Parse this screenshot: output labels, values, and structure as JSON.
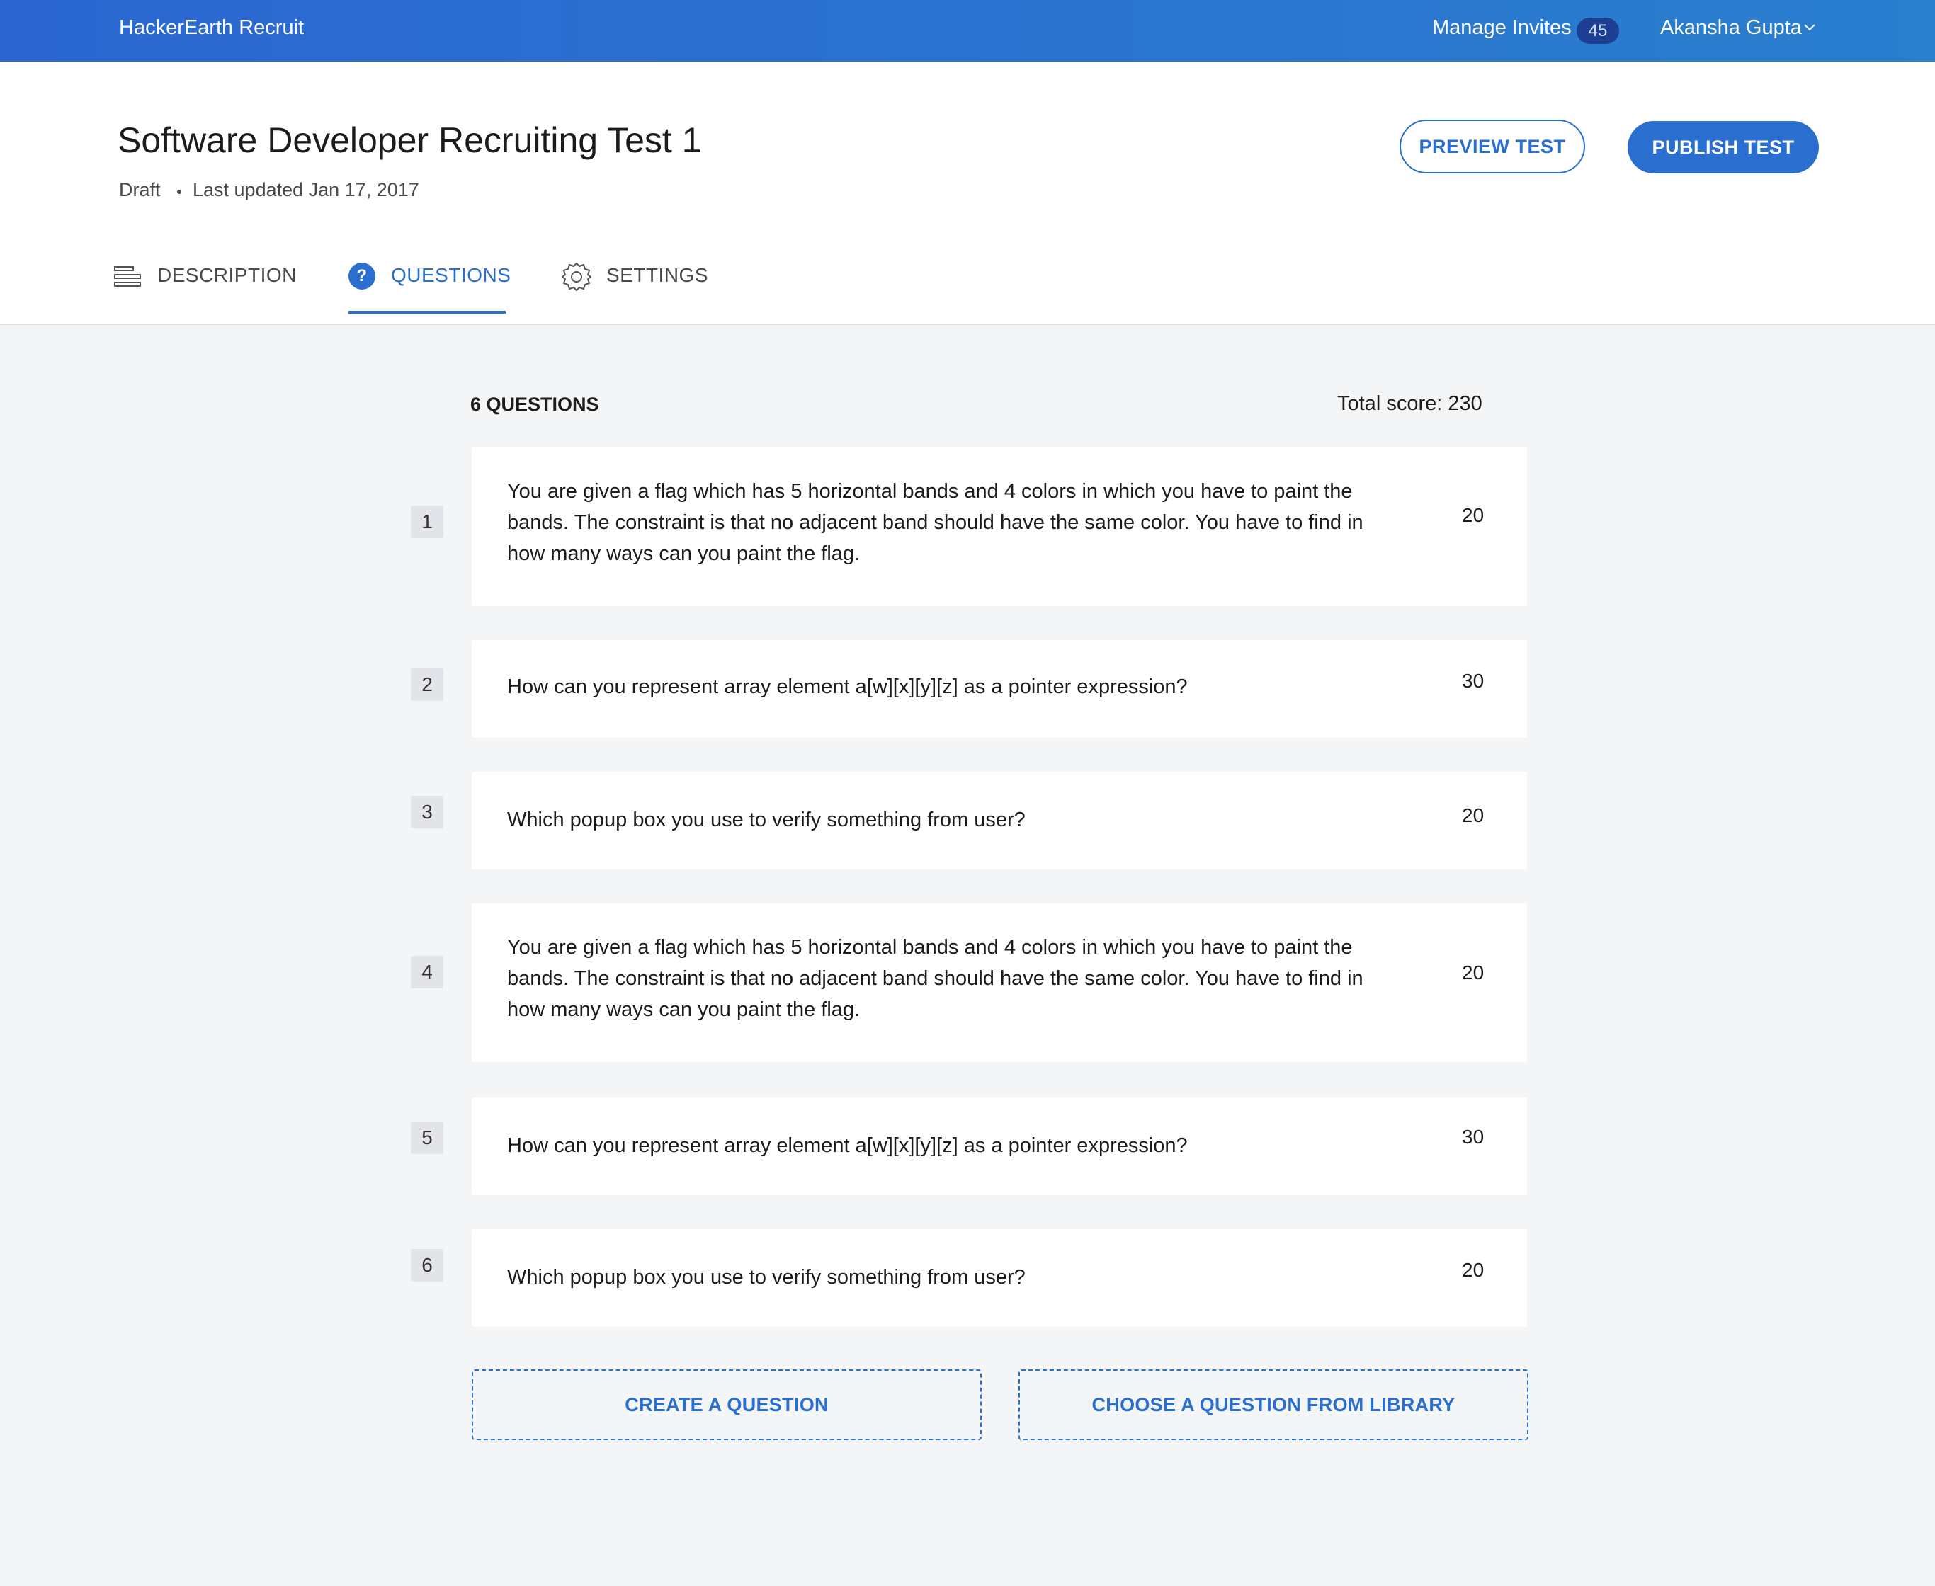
{
  "topbar": {
    "brand": "HackerEarth Recruit",
    "manage_invites": "Manage Invites",
    "invite_count": "45",
    "user_name": "Akansha Gupta"
  },
  "header": {
    "title": "Software Developer Recruiting Test 1",
    "status": "Draft",
    "last_updated": "Last updated Jan 17, 2017",
    "preview_label": "PREVIEW TEST",
    "publish_label": "PUBLISH TEST"
  },
  "tabs": [
    {
      "label": "DESCRIPTION",
      "icon": "list-icon",
      "active": false
    },
    {
      "label": "QUESTIONS",
      "icon": "question-circle-icon",
      "active": true
    },
    {
      "label": "SETTINGS",
      "icon": "gear-icon",
      "active": false
    }
  ],
  "questions_header": {
    "count_label": "6 QUESTIONS",
    "total_score": "Total score: 230"
  },
  "questions": [
    {
      "number": "1",
      "text": "You are given a flag which has 5 horizontal bands and 4 colors in which you have to paint the bands. The constraint is that no adjacent band should have the same color. You have to find in how many ways can you paint the flag.",
      "score": "20"
    },
    {
      "number": "2",
      "text": "How can you represent array element a[w][x][y][z] as a pointer expression?",
      "score": "30"
    },
    {
      "number": "3",
      "text": "Which popup box you use to verify something from user?",
      "score": "20"
    },
    {
      "number": "4",
      "text": "You are given a flag which has 5 horizontal bands and 4 colors in which you have to paint the bands. The constraint is that no adjacent band should have the same color. You have to find in how many ways can you paint the flag.",
      "score": "20"
    },
    {
      "number": "5",
      "text": "How can you represent array element a[w][x][y][z] as a pointer expression?",
      "score": "30"
    },
    {
      "number": "6",
      "text": "Which popup box you use to verify something from user?",
      "score": "20"
    }
  ],
  "actions": {
    "create_label": "CREATE A QUESTION",
    "library_label": "CHOOSE A QUESTION FROM LIBRARY"
  },
  "colors": {
    "accent": "#2a6fd0",
    "topbar_start": "#2b66d0",
    "topbar_end": "#2a7fcf",
    "page_bg": "#f4f5f7"
  }
}
